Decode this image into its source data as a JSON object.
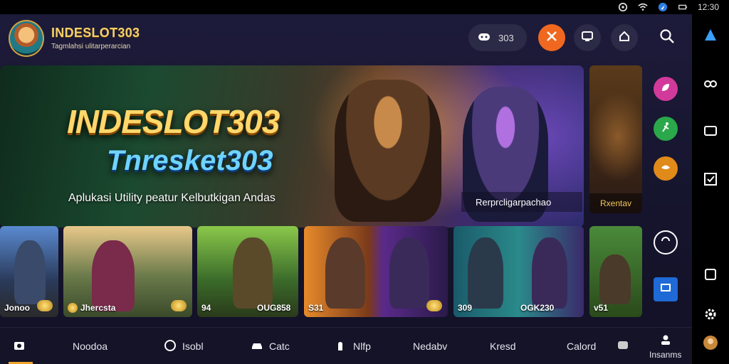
{
  "statusbar": {
    "time": "12:30"
  },
  "header": {
    "brand_title": "INDESLOT303",
    "brand_tagline": "Tagmlahsi ulitarperarcian",
    "pill_count": "303"
  },
  "hero": {
    "title": "INDESLOT303",
    "subtitle": "Tnresket303",
    "description": "Aplukasi Utility peatur Kelbutkigan Andas",
    "caption": "Rerprcligarpachao"
  },
  "side_card": {
    "label": "Rxentav"
  },
  "thumbnails": [
    {
      "label": "Jonoo"
    },
    {
      "label": "Jhercsta"
    },
    {
      "label": "94"
    },
    {
      "label": "OUG858"
    },
    {
      "label": "S31"
    },
    {
      "label": "309"
    },
    {
      "label": "OGK230"
    },
    {
      "label": "v51"
    }
  ],
  "bottom_nav": {
    "items": [
      {
        "label": "Noodoa"
      },
      {
        "label": "Isobl"
      },
      {
        "label": "Catc"
      },
      {
        "label": "Nlfp"
      },
      {
        "label": "Nedabv"
      },
      {
        "label": "Kresd"
      },
      {
        "label": "Calord"
      },
      {
        "label": "Insanms"
      }
    ]
  },
  "icons": {
    "avatar": "brand-avatar-icon",
    "pill": "controller-icon",
    "orange": "scissors-icon",
    "tv": "tv-icon",
    "home": "home-icon",
    "search": "search-icon"
  },
  "colors": {
    "accent": "#f0681f",
    "brand_gold": "#f3d16a",
    "nav_active": "#f0a52a",
    "side_icon_1": "#d13a9a",
    "side_icon_2": "#2aa84a",
    "side_icon_3": "#e08a1a"
  }
}
